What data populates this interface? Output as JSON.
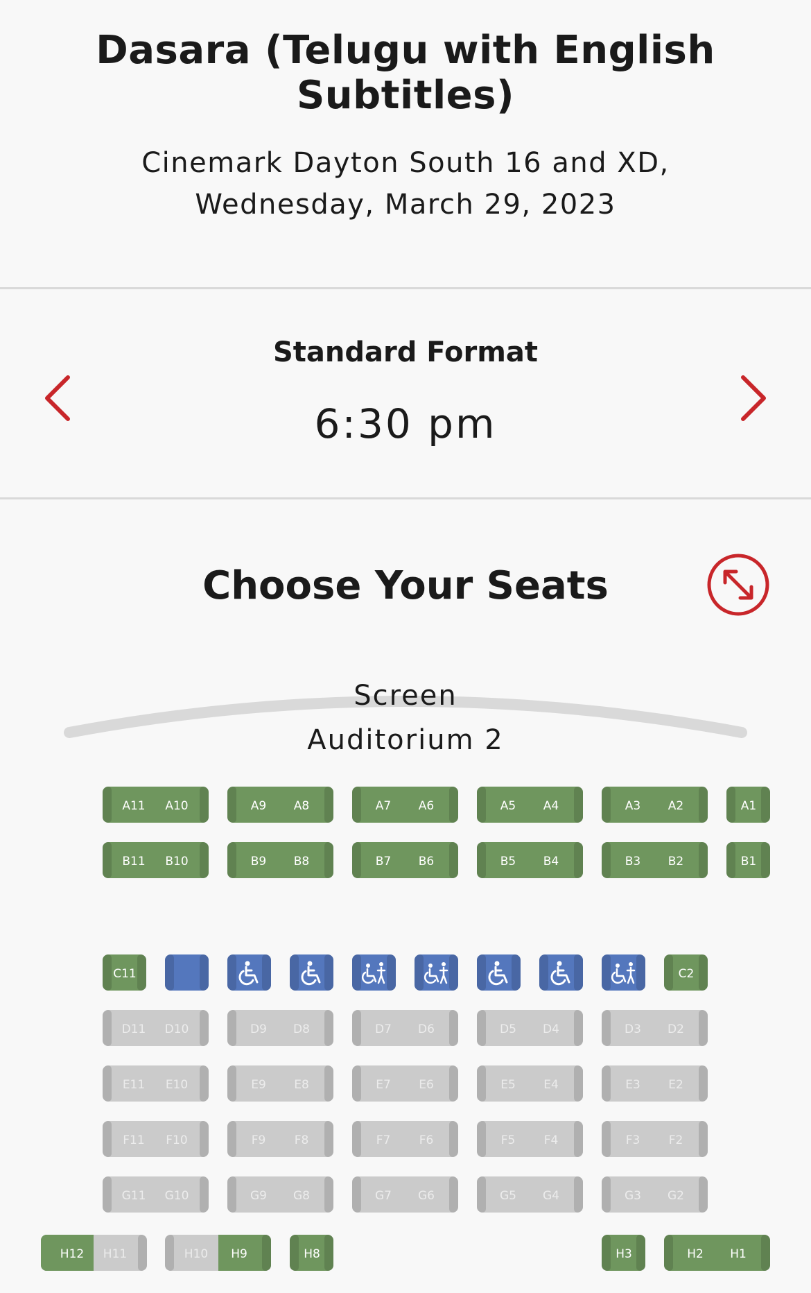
{
  "movie": {
    "title": "Dasara (Telugu with English Subtitles)",
    "venue_line1": "Cinemark Dayton South 16 and XD,",
    "venue_line2": "Wednesday, March 29, 2023"
  },
  "showtime": {
    "format": "Standard Format",
    "time": "6:30 pm",
    "prev_icon": "chevron-left-icon",
    "next_icon": "chevron-right-icon"
  },
  "seating": {
    "title": "Choose Your Seats",
    "expand_icon": "expand-icon",
    "screen_label": "Screen",
    "auditorium_label": "Auditorium 2"
  },
  "colors": {
    "available": "#6f965e",
    "unavailable": "#cbcbcb",
    "accessible": "#5477bd",
    "accent": "#c8262a"
  },
  "seats": {
    "A11": "A11",
    "A10": "A10",
    "A9": "A9",
    "A8": "A8",
    "A7": "A7",
    "A6": "A6",
    "A5": "A5",
    "A4": "A4",
    "A3": "A3",
    "A2": "A2",
    "A1": "A1",
    "B11": "B11",
    "B10": "B10",
    "B9": "B9",
    "B8": "B8",
    "B7": "B7",
    "B6": "B6",
    "B5": "B5",
    "B4": "B4",
    "B3": "B3",
    "B2": "B2",
    "B1": "B1",
    "C11": "C11",
    "C2": "C2",
    "D11": "D11",
    "D10": "D10",
    "D9": "D9",
    "D8": "D8",
    "D7": "D7",
    "D6": "D6",
    "D5": "D5",
    "D4": "D4",
    "D3": "D3",
    "D2": "D2",
    "E11": "E11",
    "E10": "E10",
    "E9": "E9",
    "E8": "E8",
    "E7": "E7",
    "E6": "E6",
    "E5": "E5",
    "E4": "E4",
    "E3": "E3",
    "E2": "E2",
    "F11": "F11",
    "F10": "F10",
    "F9": "F9",
    "F8": "F8",
    "F7": "F7",
    "F6": "F6",
    "F5": "F5",
    "F4": "F4",
    "F3": "F3",
    "F2": "F2",
    "G11": "G11",
    "G10": "G10",
    "G9": "G9",
    "G8": "G8",
    "G7": "G7",
    "G6": "G6",
    "G5": "G5",
    "G4": "G4",
    "G3": "G3",
    "G2": "G2",
    "H12": "H12",
    "H11": "H11",
    "H10": "H10",
    "H9": "H9",
    "H8": "H8",
    "H3": "H3",
    "H2": "H2",
    "H1": "H1"
  },
  "seat_status": {
    "rows_A_B_C": "available",
    "rows_D_to_G": "unavailable",
    "H11": "unavailable",
    "H10": "unavailable",
    "C_accessible_icons": [
      "wheelchair-icon",
      "wheelchair-icon",
      "wheelchair-companion-icon",
      "wheelchair-companion-icon",
      "wheelchair-icon",
      "wheelchair-icon",
      "wheelchair-companion-icon"
    ]
  }
}
